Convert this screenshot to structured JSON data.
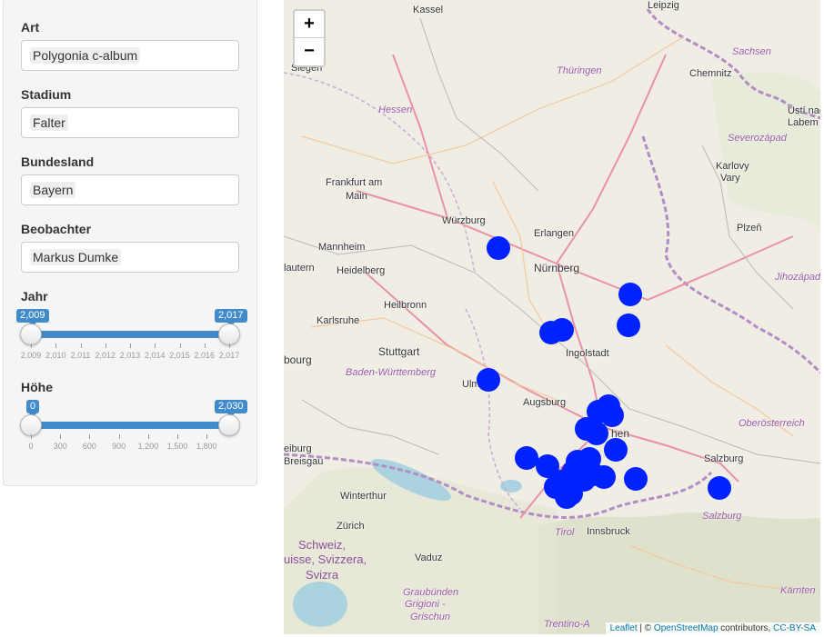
{
  "filters": {
    "art": {
      "label": "Art",
      "value": "Polygonia c-album"
    },
    "stadium": {
      "label": "Stadium",
      "value": "Falter"
    },
    "bundesland": {
      "label": "Bundesland",
      "value": "Bayern"
    },
    "beobachter": {
      "label": "Beobachter",
      "value": "Markus Dumke"
    }
  },
  "jahr_slider": {
    "label": "Jahr",
    "from_label": "2,009",
    "to_label": "2,017",
    "tick_labels": [
      "2,009",
      "2,010",
      "2,011",
      "2,012",
      "2,013",
      "2,014",
      "2,015",
      "2,016",
      "2,017"
    ]
  },
  "hoehe_slider": {
    "label": "Höhe",
    "from_label": "0",
    "to_label": "2,030",
    "tick_labels": [
      "0",
      "300",
      "600",
      "900",
      "1,200",
      "1,500",
      "1,800"
    ]
  },
  "map": {
    "zoom_in": "+",
    "zoom_out": "−",
    "marker_color": "#0022ff",
    "attribution": {
      "leaflet": "Leaflet",
      "sep": " | © ",
      "osm": "OpenStreetMap",
      "contrib": " contributors, ",
      "license": "CC-BY-SA"
    },
    "cities": {
      "kassel": "Kassel",
      "leipzig": "Leipzig",
      "siegen": "Siegen",
      "chemnitz": "Chemnitz",
      "usti": "Ústí nad",
      "labem": "Labem",
      "frankfurt": "Frankfurt am",
      "main": "Main",
      "karlovy": "Karlovy",
      "vary": "Vary",
      "wuerzburg": "Würzburg",
      "erlangen": "Erlangen",
      "mannheim": "Mannheim",
      "heidelberg": "Heidelberg",
      "lautern": "lautern",
      "nuernberg": "Nürnberg",
      "plzen": "Plzeň",
      "heilbronn": "Heilbronn",
      "karlsruhe": "Karlsruhe",
      "stuttgart": "Stuttgart",
      "ingolstadt": "Ingolstadt",
      "bourg": "bourg",
      "ulm": "Ulm",
      "augsburg": "Augsburg",
      "muenchen": "hen",
      "freiburg": "eiburg",
      "breisgau": "Breisgau",
      "salzburg": "Salzburg",
      "winterthur": "Winterthur",
      "zuerich": "Zürich",
      "vaduz": "Vaduz",
      "innsbruck": "Innsbruck"
    },
    "regions": {
      "thueringen": "Thüringen",
      "sachsen": "Sachsen",
      "hessen": "Hessen",
      "severozapad": "Severozápad",
      "jihozapad": "Jihozápad",
      "bawue": "Baden-Württemberg",
      "oberoesterreich": "Oberösterreich",
      "salzburg_land": "Salzburg",
      "tirol": "Tirol",
      "kaernten": "Kärnten",
      "graubuenden": "Graubünden",
      "grigioni": "Grigioni -",
      "grischun": "Grischun",
      "trentino": "Trentino-A"
    },
    "countries": {
      "schweiz": "Schweiz,",
      "suisse": "uisse, Svizzera,",
      "svizra": "Svizra"
    }
  }
}
